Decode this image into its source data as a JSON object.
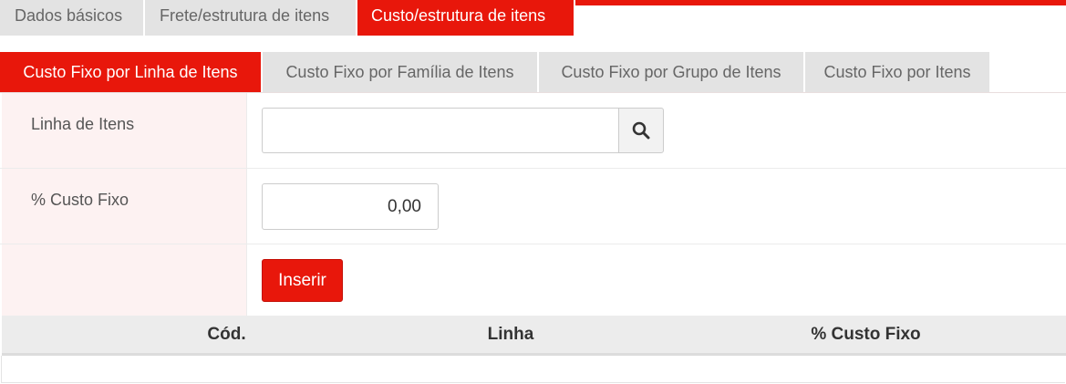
{
  "tabs": [
    {
      "label": "Dados básicos",
      "active": false
    },
    {
      "label": "Frete/estrutura de itens",
      "active": false
    },
    {
      "label": "Custo/estrutura de itens",
      "active": true
    }
  ],
  "subtabs": [
    {
      "label": "Custo Fixo por Linha de Itens",
      "active": true
    },
    {
      "label": "Custo Fixo por Família de Itens",
      "active": false
    },
    {
      "label": "Custo Fixo por Grupo de Itens",
      "active": false
    },
    {
      "label": "Custo Fixo por Itens",
      "active": false
    }
  ],
  "form": {
    "linha_label": "Linha de Itens",
    "linha_value": "",
    "search_icon": "search-icon",
    "custo_label": "% Custo Fixo",
    "custo_value": "0,00",
    "insert_label": "Inserir"
  },
  "table": {
    "columns": [
      "Cód.",
      "Linha",
      "% Custo Fixo"
    ],
    "rows": []
  },
  "colors": {
    "accent": "#e8170b",
    "tab_inactive": "#e3e3e3",
    "label_bg": "#fdf2f2"
  }
}
